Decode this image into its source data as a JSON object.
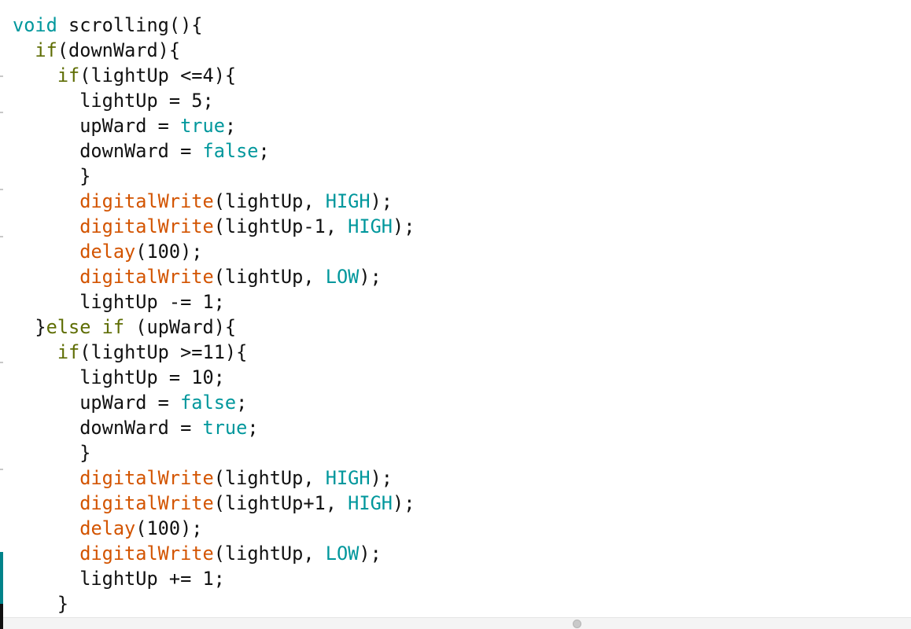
{
  "editor": {
    "code_lines": [
      [
        {
          "t": "void",
          "c": "kw"
        },
        {
          "t": " scrolling(){",
          "c": ""
        }
      ],
      [
        {
          "t": "  ",
          "c": ""
        },
        {
          "t": "if",
          "c": "ctl"
        },
        {
          "t": "(downWard){",
          "c": ""
        }
      ],
      [
        {
          "t": "    ",
          "c": ""
        },
        {
          "t": "if",
          "c": "ctl"
        },
        {
          "t": "(lightUp <=4){",
          "c": ""
        }
      ],
      [
        {
          "t": "      lightUp = 5;",
          "c": ""
        }
      ],
      [
        {
          "t": "      upWard = ",
          "c": ""
        },
        {
          "t": "true",
          "c": "kw"
        },
        {
          "t": ";",
          "c": ""
        }
      ],
      [
        {
          "t": "      downWard = ",
          "c": ""
        },
        {
          "t": "false",
          "c": "kw"
        },
        {
          "t": ";",
          "c": ""
        }
      ],
      [
        {
          "t": "      }",
          "c": ""
        }
      ],
      [
        {
          "t": "      ",
          "c": ""
        },
        {
          "t": "digitalWrite",
          "c": "fn"
        },
        {
          "t": "(lightUp, ",
          "c": ""
        },
        {
          "t": "HIGH",
          "c": "kw"
        },
        {
          "t": ");",
          "c": ""
        }
      ],
      [
        {
          "t": "      ",
          "c": ""
        },
        {
          "t": "digitalWrite",
          "c": "fn"
        },
        {
          "t": "(lightUp-1, ",
          "c": ""
        },
        {
          "t": "HIGH",
          "c": "kw"
        },
        {
          "t": ");",
          "c": ""
        }
      ],
      [
        {
          "t": "      ",
          "c": ""
        },
        {
          "t": "delay",
          "c": "fn"
        },
        {
          "t": "(100);",
          "c": ""
        }
      ],
      [
        {
          "t": "      ",
          "c": ""
        },
        {
          "t": "digitalWrite",
          "c": "fn"
        },
        {
          "t": "(lightUp, ",
          "c": ""
        },
        {
          "t": "LOW",
          "c": "kw"
        },
        {
          "t": ");",
          "c": ""
        }
      ],
      [
        {
          "t": "      lightUp -= 1;",
          "c": ""
        }
      ],
      [
        {
          "t": "  }",
          "c": ""
        },
        {
          "t": "else",
          "c": "ctl"
        },
        {
          "t": " ",
          "c": ""
        },
        {
          "t": "if",
          "c": "ctl"
        },
        {
          "t": " (upWard){",
          "c": ""
        }
      ],
      [
        {
          "t": "    ",
          "c": ""
        },
        {
          "t": "if",
          "c": "ctl"
        },
        {
          "t": "(lightUp >=11){",
          "c": ""
        }
      ],
      [
        {
          "t": "      lightUp = 10;",
          "c": ""
        }
      ],
      [
        {
          "t": "      upWard = ",
          "c": ""
        },
        {
          "t": "false",
          "c": "kw"
        },
        {
          "t": ";",
          "c": ""
        }
      ],
      [
        {
          "t": "      downWard = ",
          "c": ""
        },
        {
          "t": "true",
          "c": "kw"
        },
        {
          "t": ";",
          "c": ""
        }
      ],
      [
        {
          "t": "      }",
          "c": ""
        }
      ],
      [
        {
          "t": "      ",
          "c": ""
        },
        {
          "t": "digitalWrite",
          "c": "fn"
        },
        {
          "t": "(lightUp, ",
          "c": ""
        },
        {
          "t": "HIGH",
          "c": "kw"
        },
        {
          "t": ");",
          "c": ""
        }
      ],
      [
        {
          "t": "      ",
          "c": ""
        },
        {
          "t": "digitalWrite",
          "c": "fn"
        },
        {
          "t": "(lightUp+1, ",
          "c": ""
        },
        {
          "t": "HIGH",
          "c": "kw"
        },
        {
          "t": ");",
          "c": ""
        }
      ],
      [
        {
          "t": "      ",
          "c": ""
        },
        {
          "t": "delay",
          "c": "fn"
        },
        {
          "t": "(100);",
          "c": ""
        }
      ],
      [
        {
          "t": "      ",
          "c": ""
        },
        {
          "t": "digitalWrite",
          "c": "fn"
        },
        {
          "t": "(lightUp, ",
          "c": ""
        },
        {
          "t": "LOW",
          "c": "kw"
        },
        {
          "t": ");",
          "c": ""
        }
      ],
      [
        {
          "t": "      lightUp += 1;",
          "c": ""
        }
      ],
      [
        {
          "t": "    }",
          "c": ""
        }
      ]
    ]
  },
  "colors": {
    "keyword": "#00979c",
    "function": "#d35400",
    "control": "#5e6d03",
    "text": "#111111",
    "gutter_accent": "#00838a"
  }
}
